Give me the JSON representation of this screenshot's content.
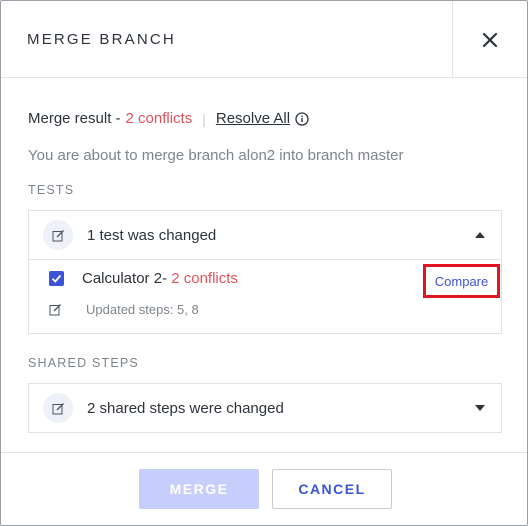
{
  "dialog": {
    "title": "MERGE BRANCH",
    "close_icon": "close-icon"
  },
  "merge_result": {
    "label": "Merge result -",
    "conflicts": "2 conflicts",
    "separator": "|",
    "resolve_all": "Resolve All",
    "info_icon": "info-icon"
  },
  "description": "You are about to merge branch alon2 into branch master",
  "tests": {
    "section_label": "TESTS",
    "summary": "1 test was changed",
    "expanded": true,
    "items": [
      {
        "checked": true,
        "name": "Calculator 2-",
        "conflicts": "2 conflicts",
        "compare_label": "Compare",
        "updated_steps": "Updated steps: 5, 8"
      }
    ]
  },
  "shared_steps": {
    "section_label": "SHARED STEPS",
    "summary": "2 shared steps were changed",
    "expanded": false
  },
  "footer": {
    "merge_label": "MERGE",
    "cancel_label": "CANCEL"
  },
  "colors": {
    "accent": "#3c53d6",
    "conflict": "#e2525c",
    "merge_disabled": "#c7cefb",
    "highlight_border": "#e0151f"
  }
}
